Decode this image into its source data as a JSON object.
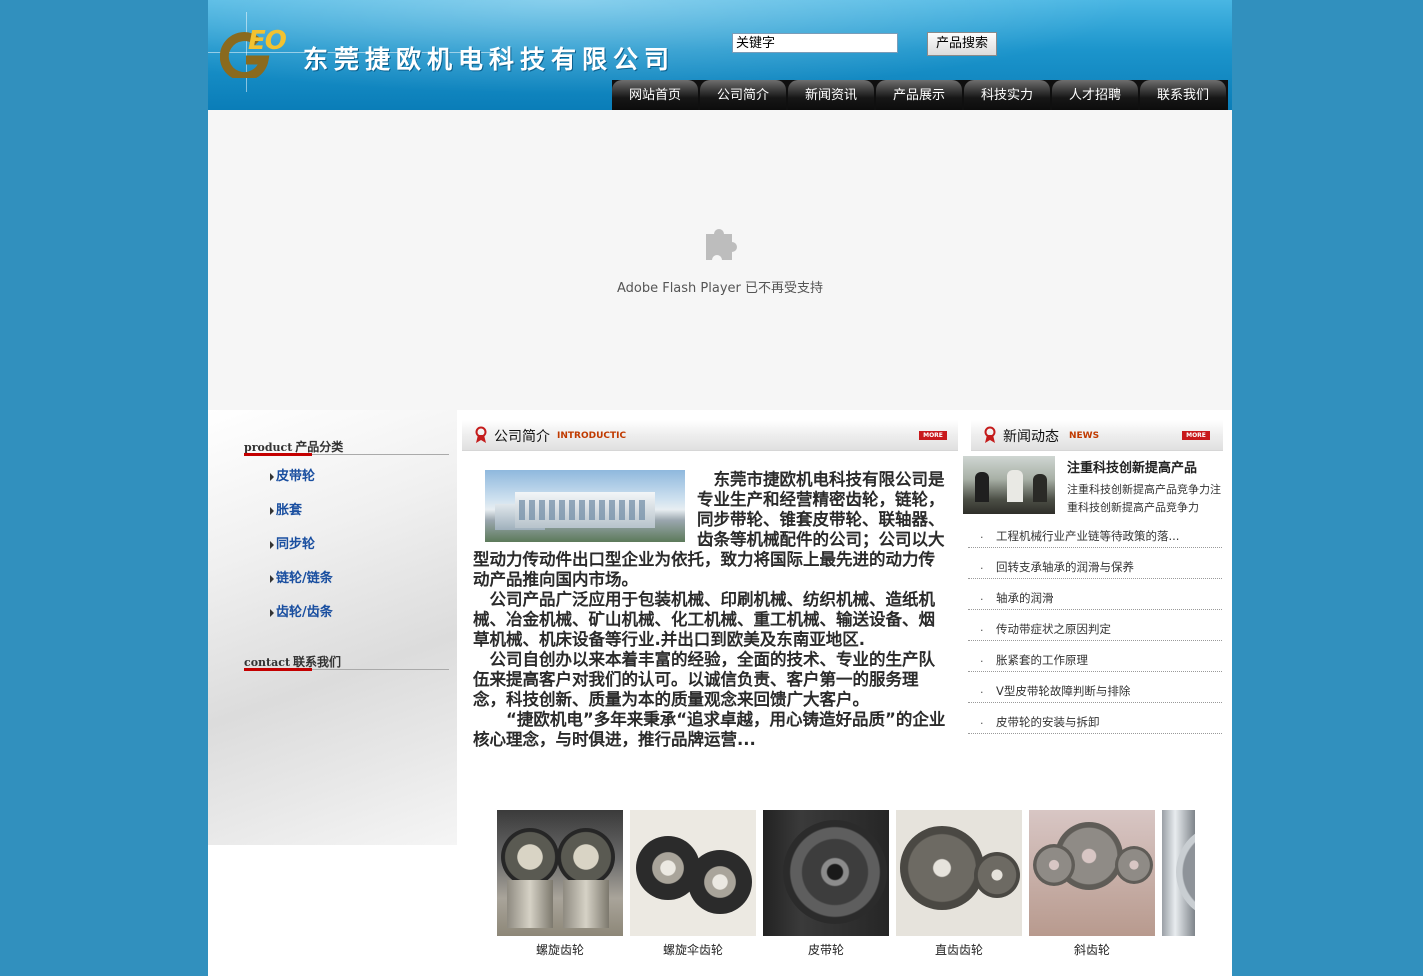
{
  "header": {
    "logo_text": "EO",
    "company_name": "东莞捷欧机电科技有限公司",
    "search": {
      "value": "关键字",
      "button_label": "产品搜索"
    },
    "nav": [
      "网站首页",
      "公司简介",
      "新闻资讯",
      "产品展示",
      "科技实力",
      "人才招聘",
      "联系我们"
    ]
  },
  "flash": {
    "message": "Adobe Flash Player 已不再受支持"
  },
  "sidebar": {
    "product_heading": {
      "en": "product",
      "cn": "产品分类"
    },
    "categories": [
      "皮带轮",
      "胀套",
      "同步轮",
      "链轮/链条",
      "齿轮/齿条"
    ],
    "contact_heading": {
      "en": "contact",
      "cn": "联系我们"
    }
  },
  "intro": {
    "title_cn": "公司简介",
    "title_en": "INTRODUCTIC",
    "more_label": "MORE",
    "paragraphs": [
      "东莞市捷欧机电科技有限公司是专业生产和经营精密齿轮，链轮，同步带轮、锥套皮带轮、联轴器、齿条等机械配件的公司；公司以大型动力传动件出口型企业为依托，致力将国际上最先进的动力传动产品推向国内市场。",
      "公司产品广泛应用于包装机械、印刷机械、纺织机械、造纸机械、冶金机械、矿山机械、化工机械、重工机械、输送设备、烟草机械、机床设备等行业.并出口到欧美及东南亚地区.",
      "公司自创办以来本着丰富的经验，全面的技术、专业的生产队伍来提高客户对我们的认可。以诚信负责、客户第一的服务理念，科技创新、质量为本的质量观念来回馈广大客户。",
      "“捷欧机电”多年来秉承“追求卓越，用心铸造好品质”的企业核心理念，与时俱进，推行品牌运营..."
    ]
  },
  "news": {
    "title_cn": "新闻动态",
    "title_en": "NEWS",
    "more_label": "MORE",
    "featured": {
      "title": "注重科技创新提高产品",
      "summary": "注重科技创新提高产品竞争力注重科技创新提高产品竞争力"
    },
    "items": [
      "工程机械行业产业链等待政策的落...",
      "回转支承轴承的润滑与保养",
      "轴承的润滑",
      "传动带症状之原因判定",
      "胀紧套的工作原理",
      "V型皮带轮故障判断与排除",
      "皮带轮的安装与拆卸"
    ]
  },
  "products": [
    "螺旋齿轮",
    "螺旋伞齿轮",
    "皮带轮",
    "直齿齿轮",
    "斜齿轮"
  ],
  "colors": {
    "page_bg": "#3190be",
    "header_blue": "#1c95cc",
    "accent_red": "#c40000",
    "link_blue": "#1a4fa0",
    "logo_gold": "#f2c230"
  }
}
